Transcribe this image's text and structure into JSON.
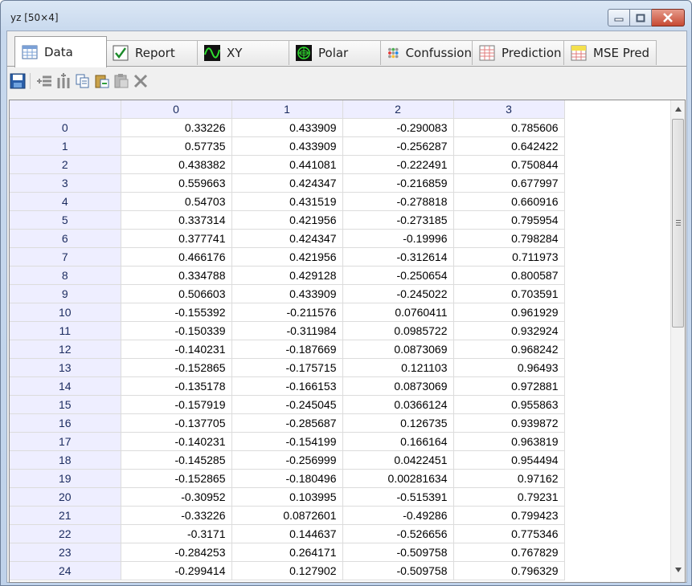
{
  "window": {
    "title": "yz [50×4]",
    "controls": [
      "minimize-icon",
      "maximize-icon",
      "close-icon"
    ]
  },
  "tabs": [
    {
      "label": "Data",
      "icon": "table-icon",
      "active": true
    },
    {
      "label": "Report",
      "icon": "checkbox-icon",
      "active": false
    },
    {
      "label": "XY",
      "icon": "wave-chart-icon",
      "active": false
    },
    {
      "label": "Polar",
      "icon": "polar-chart-icon",
      "active": false
    },
    {
      "label": "Confussion",
      "icon": "dots-matrix-icon",
      "active": false
    },
    {
      "label": "Prediction",
      "icon": "grid-table-icon",
      "active": false
    },
    {
      "label": "MSE Pred",
      "icon": "mse-icon",
      "active": false
    }
  ],
  "toolbar": [
    "save-icon",
    "insert-row-icon",
    "insert-column-icon",
    "copy-icon",
    "paste-special-icon",
    "paste-icon",
    "delete-icon"
  ],
  "grid": {
    "columns": [
      "0",
      "1",
      "2",
      "3"
    ],
    "rows": [
      {
        "index": "0",
        "cells": [
          "0.33226",
          "0.433909",
          "-0.290083",
          "0.785606"
        ]
      },
      {
        "index": "1",
        "cells": [
          "0.57735",
          "0.433909",
          "-0.256287",
          "0.642422"
        ]
      },
      {
        "index": "2",
        "cells": [
          "0.438382",
          "0.441081",
          "-0.222491",
          "0.750844"
        ]
      },
      {
        "index": "3",
        "cells": [
          "0.559663",
          "0.424347",
          "-0.216859",
          "0.677997"
        ]
      },
      {
        "index": "4",
        "cells": [
          "0.54703",
          "0.431519",
          "-0.278818",
          "0.660916"
        ]
      },
      {
        "index": "5",
        "cells": [
          "0.337314",
          "0.421956",
          "-0.273185",
          "0.795954"
        ]
      },
      {
        "index": "6",
        "cells": [
          "0.377741",
          "0.424347",
          "-0.19996",
          "0.798284"
        ]
      },
      {
        "index": "7",
        "cells": [
          "0.466176",
          "0.421956",
          "-0.312614",
          "0.711973"
        ]
      },
      {
        "index": "8",
        "cells": [
          "0.334788",
          "0.429128",
          "-0.250654",
          "0.800587"
        ]
      },
      {
        "index": "9",
        "cells": [
          "0.506603",
          "0.433909",
          "-0.245022",
          "0.703591"
        ]
      },
      {
        "index": "10",
        "cells": [
          "-0.155392",
          "-0.211576",
          "0.0760411",
          "0.961929"
        ]
      },
      {
        "index": "11",
        "cells": [
          "-0.150339",
          "-0.311984",
          "0.0985722",
          "0.932924"
        ]
      },
      {
        "index": "12",
        "cells": [
          "-0.140231",
          "-0.187669",
          "0.0873069",
          "0.968242"
        ]
      },
      {
        "index": "13",
        "cells": [
          "-0.152865",
          "-0.175715",
          "0.121103",
          "0.96493"
        ]
      },
      {
        "index": "14",
        "cells": [
          "-0.135178",
          "-0.166153",
          "0.0873069",
          "0.972881"
        ]
      },
      {
        "index": "15",
        "cells": [
          "-0.157919",
          "-0.245045",
          "0.0366124",
          "0.955863"
        ]
      },
      {
        "index": "16",
        "cells": [
          "-0.137705",
          "-0.285687",
          "0.126735",
          "0.939872"
        ]
      },
      {
        "index": "17",
        "cells": [
          "-0.140231",
          "-0.154199",
          "0.166164",
          "0.963819"
        ]
      },
      {
        "index": "18",
        "cells": [
          "-0.145285",
          "-0.256999",
          "0.0422451",
          "0.954494"
        ]
      },
      {
        "index": "19",
        "cells": [
          "-0.152865",
          "-0.180496",
          "0.00281634",
          "0.97162"
        ]
      },
      {
        "index": "20",
        "cells": [
          "-0.30952",
          "0.103995",
          "-0.515391",
          "0.79231"
        ]
      },
      {
        "index": "21",
        "cells": [
          "-0.33226",
          "0.0872601",
          "-0.49286",
          "0.799423"
        ]
      },
      {
        "index": "22",
        "cells": [
          "-0.3171",
          "0.144637",
          "-0.526656",
          "0.775346"
        ]
      },
      {
        "index": "23",
        "cells": [
          "-0.284253",
          "0.264171",
          "-0.509758",
          "0.767829"
        ]
      },
      {
        "index": "24",
        "cells": [
          "-0.299414",
          "0.127902",
          "-0.509758",
          "0.796329"
        ]
      }
    ]
  },
  "colors": {
    "header_bg": "#eeeeff",
    "header_text": "#1a2a5e",
    "gridline": "#dcdcdc",
    "close_button": "#c74a34"
  }
}
